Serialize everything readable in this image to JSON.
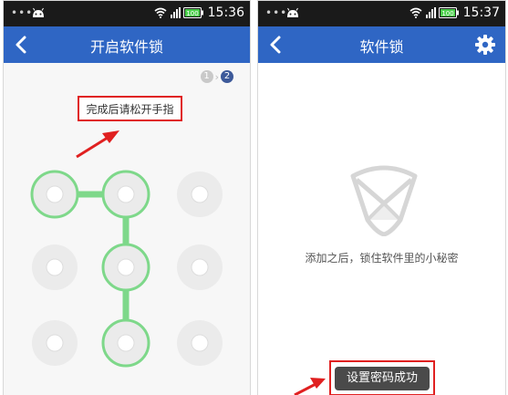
{
  "left": {
    "status": {
      "time": "15:36",
      "battery": "100"
    },
    "title": "开启软件锁",
    "steps": [
      "1",
      "2"
    ],
    "hint": "完成后请松开手指"
  },
  "right": {
    "status": {
      "time": "15:37",
      "battery": "100"
    },
    "title": "软件锁",
    "description": "添加之后，锁住软件里的小秘密",
    "toast": "设置密码成功"
  },
  "colors": {
    "title_bar": "#2f66c4",
    "status_bar": "#1a1a1a",
    "pattern_active": "#7ed88a",
    "highlight": "#e02020",
    "step_active": "#3d5a9a"
  },
  "pattern": {
    "selected_nodes": [
      1,
      2,
      5,
      8
    ],
    "sequence": [
      1,
      2,
      5,
      8
    ]
  }
}
